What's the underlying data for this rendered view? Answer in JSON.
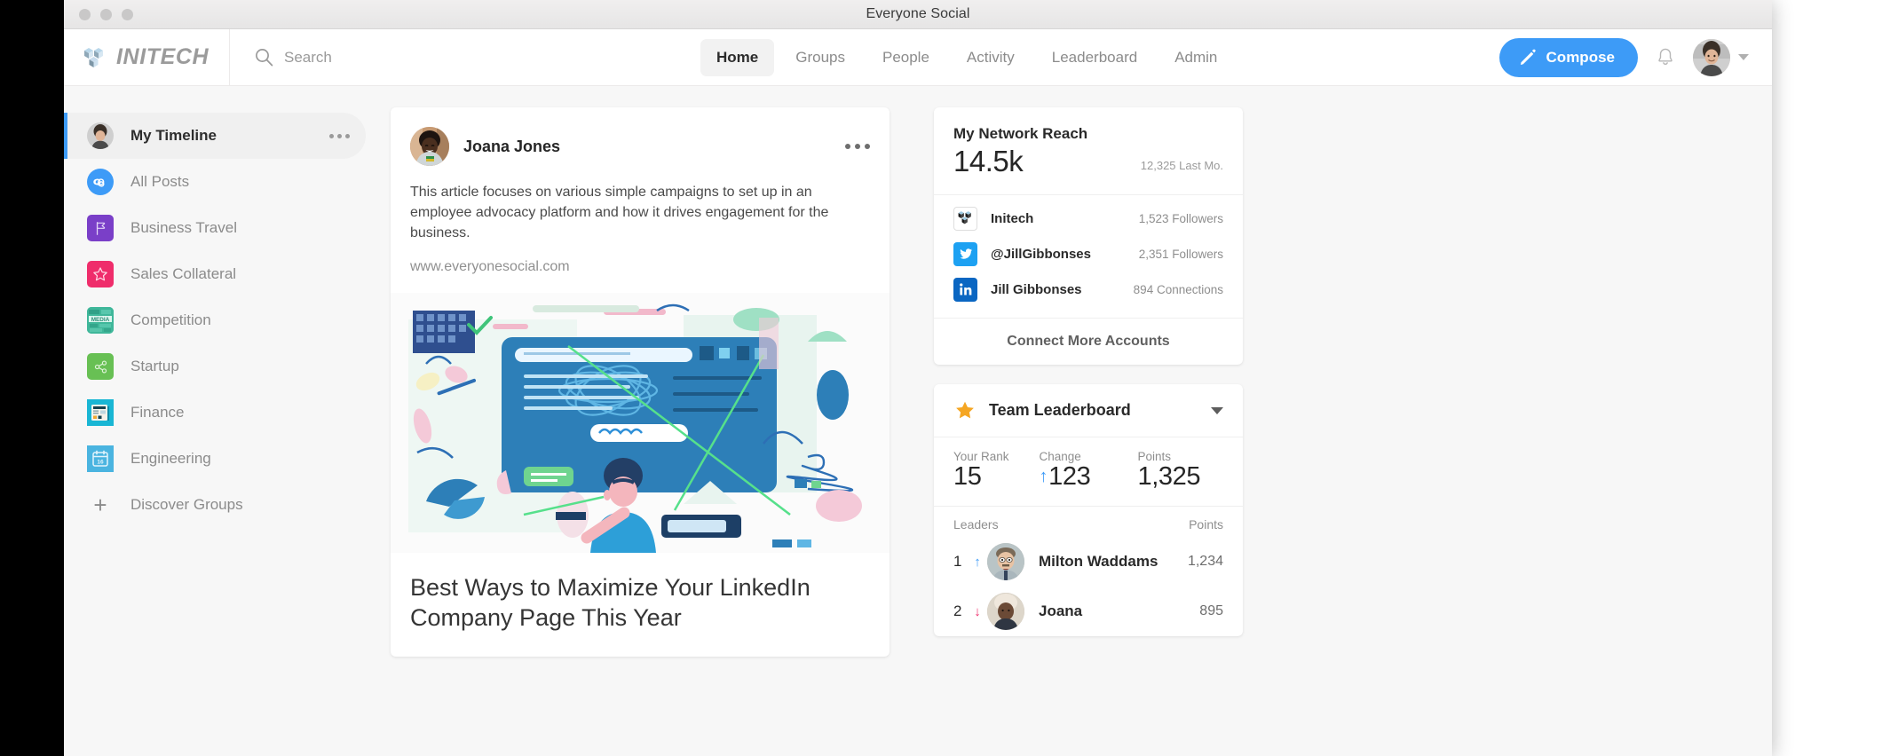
{
  "window": {
    "title": "Everyone Social"
  },
  "nav": {
    "brand": "INITECH",
    "search_placeholder": "Search",
    "links": [
      {
        "label": "Home",
        "active": true
      },
      {
        "label": "Groups",
        "active": false
      },
      {
        "label": "People",
        "active": false
      },
      {
        "label": "Activity",
        "active": false
      },
      {
        "label": "Leaderboard",
        "active": false
      },
      {
        "label": "Admin",
        "active": false
      }
    ],
    "compose_label": "Compose"
  },
  "sidebar": {
    "items": [
      {
        "label": "My Timeline",
        "icon": "user-avatar-icon",
        "color": "#cbb9a8",
        "active": true
      },
      {
        "label": "All Posts",
        "icon": "infinity-icon",
        "color": "#3d9bf7",
        "active": false
      },
      {
        "label": "Business Travel",
        "icon": "flag-icon",
        "color": "#7a3fc8",
        "active": false
      },
      {
        "label": "Sales Collateral",
        "icon": "star-icon",
        "color": "#ef2d6b",
        "active": false
      },
      {
        "label": "Competition",
        "icon": "social-media-tile-icon",
        "color": "#3fb79a",
        "active": false
      },
      {
        "label": "Startup",
        "icon": "share-icon",
        "color": "#68c054",
        "active": false
      },
      {
        "label": "Finance",
        "icon": "newspaper-icon",
        "color": "#19b6d4",
        "active": false
      },
      {
        "label": "Engineering",
        "icon": "calendar-icon",
        "color": "#4ab4e0",
        "active": false
      }
    ],
    "discover_label": "Discover Groups"
  },
  "post": {
    "author": "Joana Jones",
    "body": "This article focuses on various simple campaigns to set up in an employee advocacy platform and how it drives engagement for the business.",
    "url": "www.everyonesocial.com",
    "title": "Best Ways to Maximize Your LinkedIn Company Page This Year"
  },
  "reach": {
    "title": "My Network Reach",
    "value": "14.5k",
    "last_month": "12,325 Last Mo.",
    "accounts": [
      {
        "name": "Initech",
        "meta": "1,523 Followers",
        "icon": "initech-logo-icon"
      },
      {
        "name": "@JillGibbonses",
        "meta": "2,351 Followers",
        "icon": "twitter-icon"
      },
      {
        "name": "Jill Gibbonses",
        "meta": "894 Connections",
        "icon": "linkedin-icon"
      }
    ],
    "connect_more": "Connect More Accounts"
  },
  "leaderboard": {
    "title": "Team Leaderboard",
    "stats": [
      {
        "label": "Your Rank",
        "value": "15",
        "arrow": ""
      },
      {
        "label": "Change",
        "value": "123",
        "arrow": "up"
      },
      {
        "label": "Points",
        "value": "1,325",
        "arrow": ""
      }
    ],
    "col_leaders": "Leaders",
    "col_points": "Points",
    "rows": [
      {
        "rank": "1",
        "change": "up",
        "name": "Milton Waddams",
        "points": "1,234"
      },
      {
        "rank": "2",
        "change": "down",
        "name": "Joana",
        "points": "895"
      }
    ]
  },
  "colors": {
    "accent": "#3d9bf7",
    "star": "#f5a623",
    "down": "#ef2d6b",
    "twitter": "#1da1f2",
    "linkedin": "#0a66c2"
  }
}
